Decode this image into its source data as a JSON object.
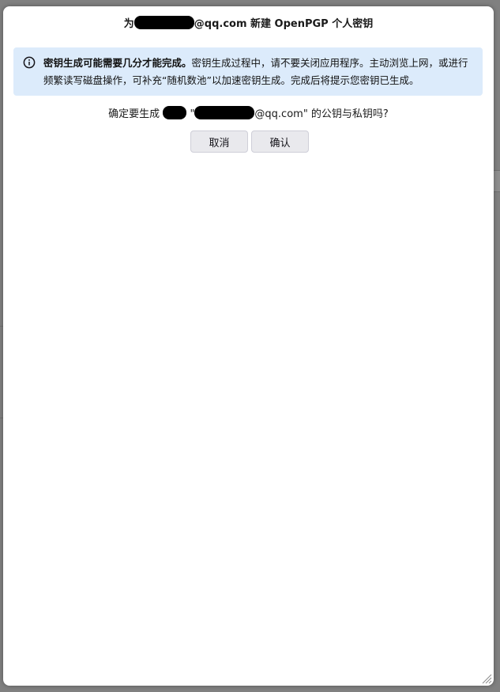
{
  "dialog": {
    "title_prefix": "为",
    "title_suffix": "@qq.com 新建 OpenPGP 个人密钥",
    "notice": {
      "bold": "密钥生成可能需要几分才能完成。",
      "text": "密钥生成过程中，请不要关闭应用程序。主动浏览上网，或进行频繁读写磁盘操作，可补充“随机数池”以加速密钥生成。完成后将提示您密钥已生成。"
    },
    "confirm": {
      "prefix": "确定要生成",
      "quote_open": "\"",
      "suffix": "@qq.com\" 的公钥与私钥吗?"
    },
    "cancel_label": "取消",
    "ok_label": "确认"
  },
  "icons": {
    "info": "info-circle-icon",
    "resize": "resize-grip-icon"
  },
  "colors": {
    "notice_bg": "#dcebfb",
    "button_bg": "#e9e9ed",
    "redaction": "#000000"
  }
}
